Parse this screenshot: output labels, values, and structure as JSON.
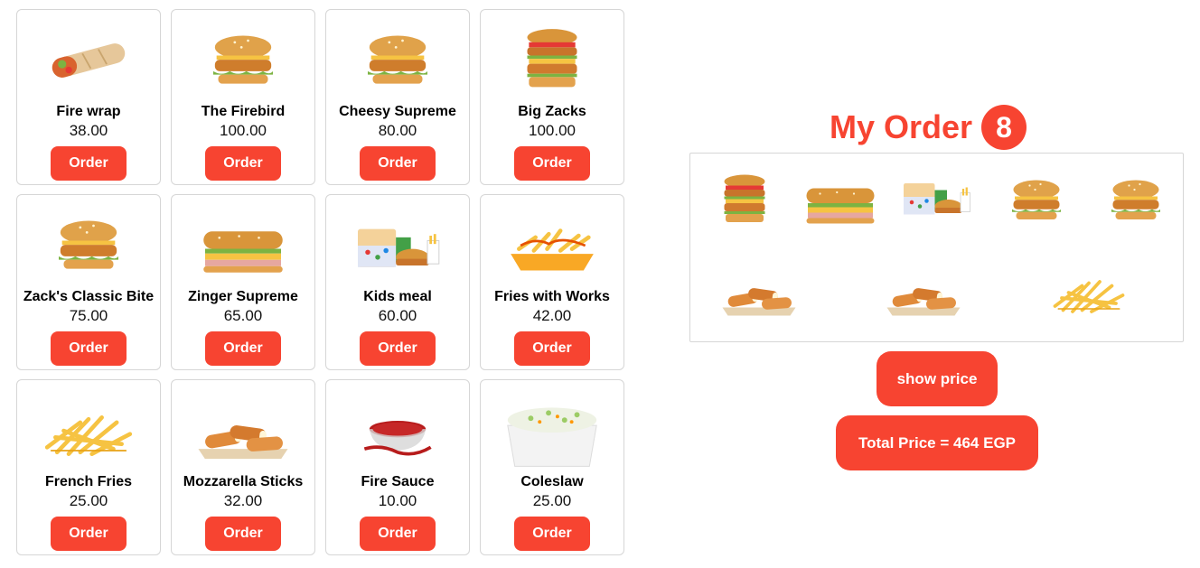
{
  "menu": {
    "items": [
      {
        "name": "Fire wrap",
        "price": "38.00",
        "icon": "wrap-icon",
        "order_label": "Order"
      },
      {
        "name": "The Firebird",
        "price": "100.00",
        "icon": "burger-icon",
        "order_label": "Order"
      },
      {
        "name": "Cheesy Supreme",
        "price": "80.00",
        "icon": "burger-icon",
        "order_label": "Order"
      },
      {
        "name": "Big Zacks",
        "price": "100.00",
        "icon": "tall-burger-icon",
        "order_label": "Order"
      },
      {
        "name": "Zack's Classic Bite",
        "price": "75.00",
        "icon": "burger-icon",
        "order_label": "Order"
      },
      {
        "name": "Zinger Supreme",
        "price": "65.00",
        "icon": "sub-sandwich-icon",
        "order_label": "Order"
      },
      {
        "name": "Kids meal",
        "price": "60.00",
        "icon": "kids-meal-icon",
        "order_label": "Order"
      },
      {
        "name": "Fries with Works",
        "price": "42.00",
        "icon": "loaded-fries-icon",
        "order_label": "Order"
      },
      {
        "name": "French Fries",
        "price": "25.00",
        "icon": "fries-icon",
        "order_label": "Order"
      },
      {
        "name": "Mozzarella Sticks",
        "price": "32.00",
        "icon": "mozzarella-icon",
        "order_label": "Order"
      },
      {
        "name": "Fire Sauce",
        "price": "10.00",
        "icon": "sauce-icon",
        "order_label": "Order"
      },
      {
        "name": "Coleslaw",
        "price": "25.00",
        "icon": "coleslaw-icon",
        "order_label": "Order"
      }
    ]
  },
  "order": {
    "title": "My Order",
    "count": "8",
    "items": [
      {
        "icon": "tall-burger-icon"
      },
      {
        "icon": "sub-sandwich-icon"
      },
      {
        "icon": "kids-meal-icon"
      },
      {
        "icon": "burger-icon"
      },
      {
        "icon": "burger-icon"
      },
      {
        "icon": "mozzarella-icon"
      },
      {
        "icon": "mozzarella-icon"
      },
      {
        "icon": "fries-icon"
      }
    ],
    "show_price_label": "show price",
    "total_label": "Total Price = 464 EGP"
  },
  "colors": {
    "accent": "#f74431",
    "border": "#d6d6d6"
  }
}
